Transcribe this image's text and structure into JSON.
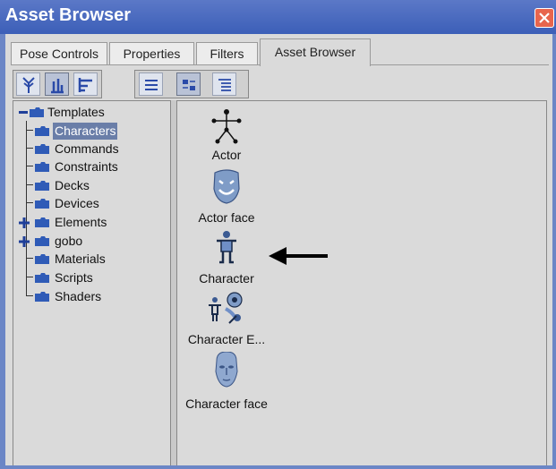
{
  "window": {
    "title": "Asset Browser"
  },
  "tabs": [
    {
      "label": "Pose Controls"
    },
    {
      "label": "Properties"
    },
    {
      "label": "Filters"
    },
    {
      "label": "Asset Browser"
    }
  ],
  "active_tab": "Asset Browser",
  "tree": {
    "root": "Templates",
    "items": [
      {
        "label": "Characters",
        "selected": true,
        "expandable": false
      },
      {
        "label": "Commands",
        "expandable": false
      },
      {
        "label": "Constraints",
        "expandable": false
      },
      {
        "label": "Decks",
        "expandable": false
      },
      {
        "label": "Devices",
        "expandable": false
      },
      {
        "label": "Elements",
        "expandable": true
      },
      {
        "label": "gobo",
        "expandable": true
      },
      {
        "label": "Materials",
        "expandable": false
      },
      {
        "label": "Scripts",
        "expandable": false
      },
      {
        "label": "Shaders",
        "expandable": false
      }
    ]
  },
  "assets": [
    {
      "label": "Actor",
      "icon": "actor-stick-figure-icon"
    },
    {
      "label": "Actor face",
      "icon": "actor-face-icon"
    },
    {
      "label": "Character",
      "icon": "character-figure-icon"
    },
    {
      "label": "Character E...",
      "icon": "character-elements-icon"
    },
    {
      "label": "Character face",
      "icon": "character-face-icon"
    }
  ],
  "colors": {
    "titlebar": "#3c5fb8",
    "panel": "#dadada",
    "selection": "#6a7ea8",
    "close": "#e8654d"
  }
}
